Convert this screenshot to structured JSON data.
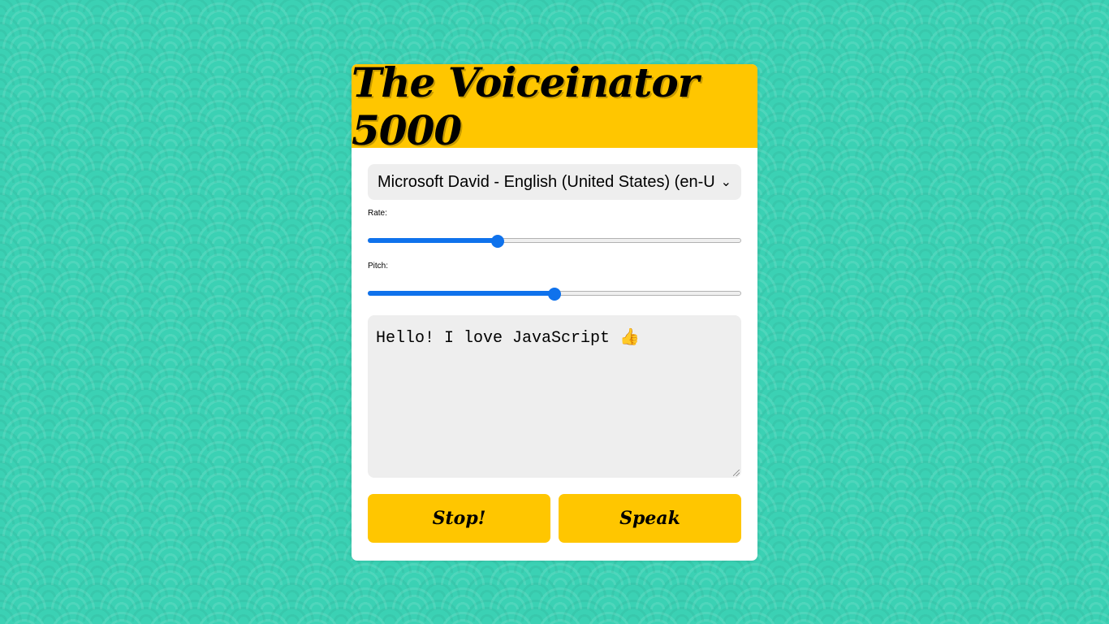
{
  "app": {
    "title": "The Voiceinator 5000"
  },
  "voice": {
    "selected": "Microsoft David - English (United States) (en-US)"
  },
  "rate": {
    "label": "Rate:",
    "value_fraction": 0.347
  },
  "pitch": {
    "label": "Pitch:",
    "value_fraction": 0.5
  },
  "message": {
    "text": "Hello! I love JavaScript 👍"
  },
  "buttons": {
    "stop": "Stop!",
    "speak": "Speak"
  },
  "colors": {
    "accent": "#ffc600",
    "background": "#3bd1b4",
    "slider": "#0f72ec",
    "field": "#eeeeee"
  }
}
